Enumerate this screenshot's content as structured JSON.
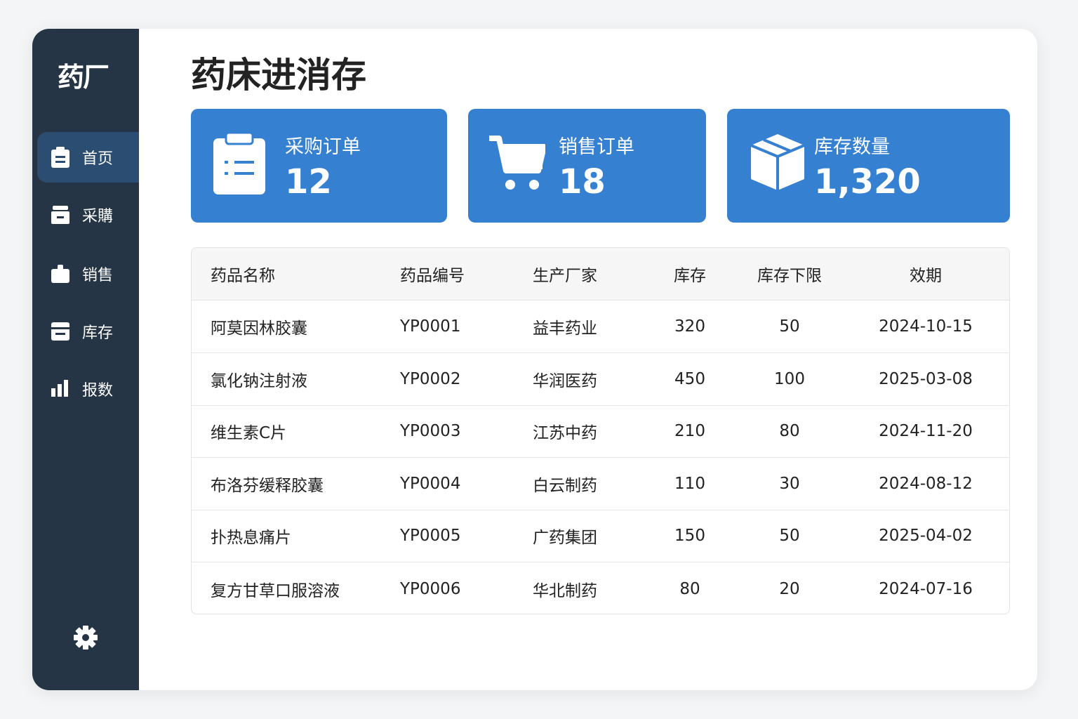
{
  "app": {
    "logo": "药厂",
    "title": "药床进消存"
  },
  "sidebar": {
    "items": [
      {
        "label": "首页",
        "icon": "clipboard-icon"
      },
      {
        "label": "采購",
        "icon": "box-icon"
      },
      {
        "label": "销售",
        "icon": "bag-icon"
      },
      {
        "label": "库存",
        "icon": "archive-icon"
      },
      {
        "label": "报数",
        "icon": "bar-chart-icon"
      }
    ],
    "settings_icon": "gear-icon"
  },
  "stats": [
    {
      "label": "采购订单",
      "value": "12",
      "icon": "clipboard-list-icon"
    },
    {
      "label": "销售订单",
      "value": "18",
      "icon": "cart-icon"
    },
    {
      "label": "库存数量",
      "value": "1,320",
      "icon": "package-icon"
    }
  ],
  "colors": {
    "sidebar": "#253545",
    "accent": "#3580d0",
    "active": "#2c4d72"
  },
  "table": {
    "headers": [
      "药品名称",
      "药品编号",
      "生产厂家",
      "库存",
      "库存下限",
      "效期"
    ],
    "rows": [
      [
        "阿莫因林胶囊",
        "YP0001",
        "益丰药业",
        "320",
        "50",
        "2024-10-15"
      ],
      [
        "氯化钠注射液",
        "YP0002",
        "华润医药",
        "450",
        "100",
        "2025-03-08"
      ],
      [
        "维生素C片",
        "YP0003",
        "江苏中药",
        "210",
        "80",
        "2024-11-20"
      ],
      [
        "布洛芬缓释胶囊",
        "YP0004",
        "白云制药",
        "110",
        "30",
        "2024-08-12"
      ],
      [
        "扑热息痛片",
        "YP0005",
        "广药集团",
        "150",
        "50",
        "2025-04-02"
      ],
      [
        "复方甘草口服溶液",
        "YP0006",
        "华北制药",
        "80",
        "20",
        "2024-07-16"
      ]
    ]
  }
}
